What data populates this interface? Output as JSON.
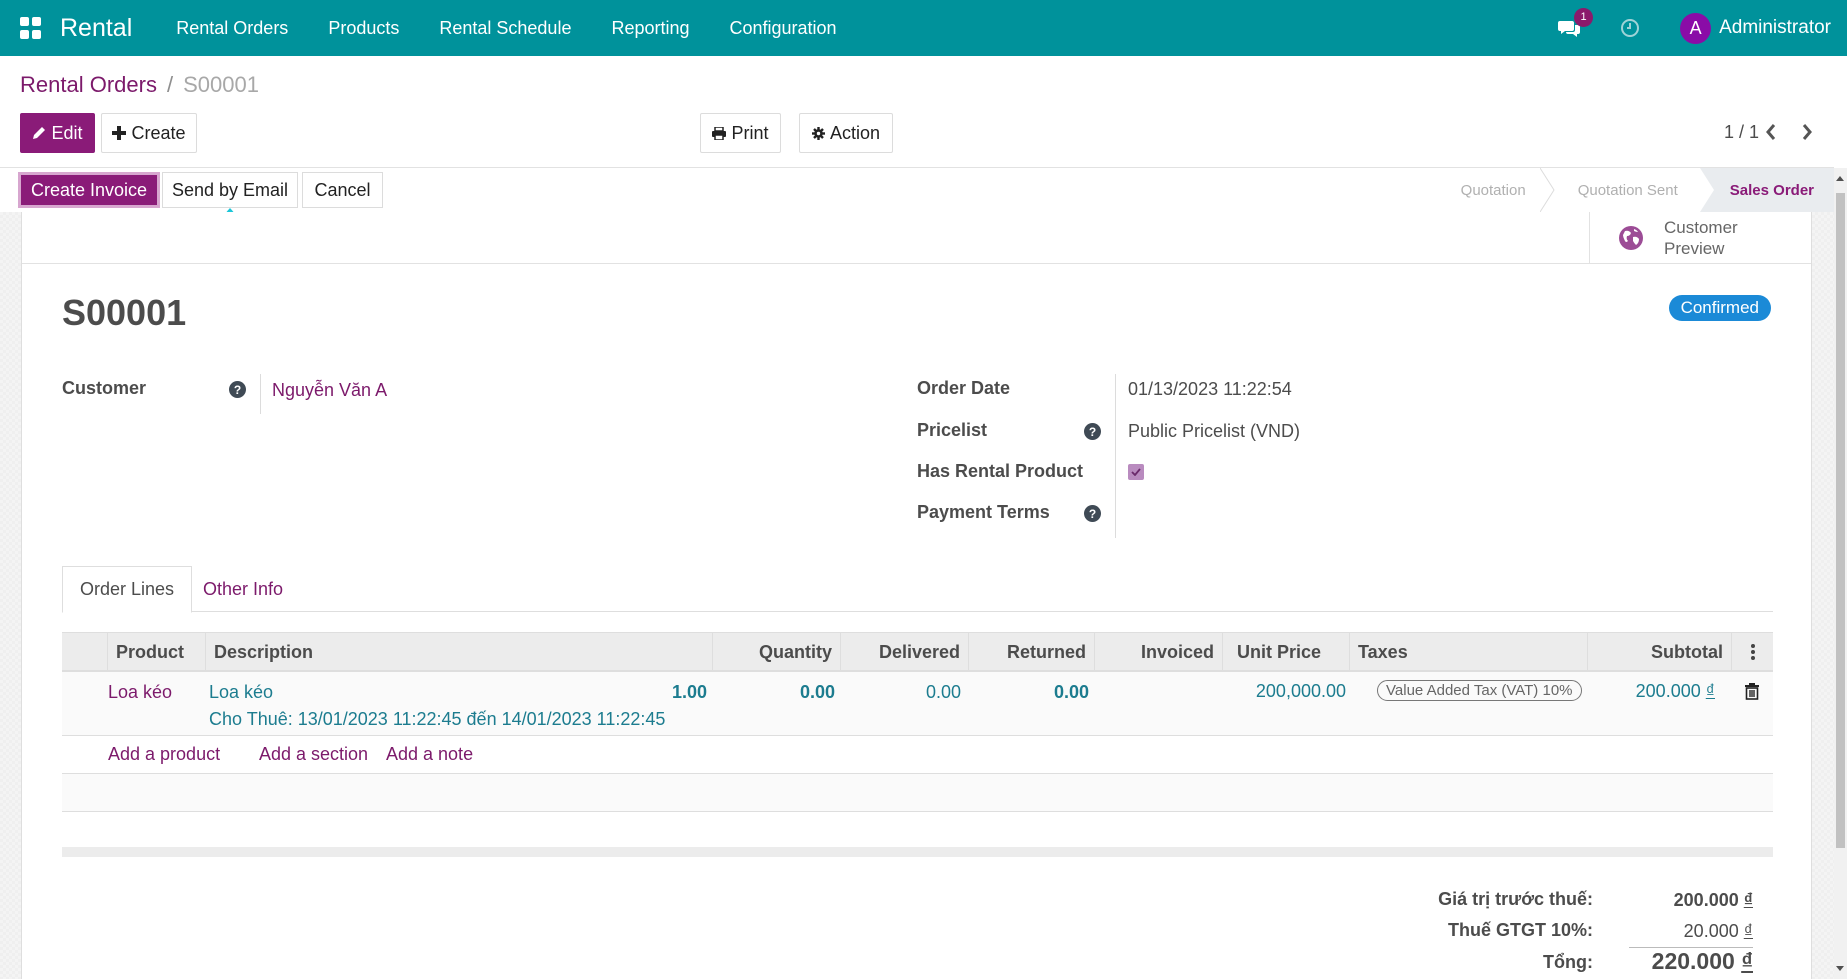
{
  "navbar": {
    "app_name": "Rental",
    "menu": [
      "Rental Orders",
      "Products",
      "Rental Schedule",
      "Reporting",
      "Configuration"
    ],
    "messages_count": "1",
    "user_initial": "A",
    "user_name": "Administrator",
    "brand_color": "#00929b"
  },
  "breadcrumb": {
    "parent": "Rental Orders",
    "separator": "/",
    "current": "S00001"
  },
  "toolbar": {
    "edit_label": "Edit",
    "create_label": "Create",
    "print_label": "Print",
    "action_label": "Action",
    "pager": "1 / 1"
  },
  "statusbar": {
    "buttons": [
      "Create Invoice",
      "Send by Email",
      "Cancel"
    ],
    "stages": [
      "Quotation",
      "Quotation Sent",
      "Sales Order"
    ],
    "active_stage": "Sales Order"
  },
  "smart_buttons": {
    "customer_preview_line1": "Customer",
    "customer_preview_line2": "Preview"
  },
  "record": {
    "name": "S00001",
    "status": "Confirmed",
    "customer_label": "Customer",
    "customer_value": "Nguyễn Văn A",
    "order_date_label": "Order Date",
    "order_date_value": "01/13/2023 11:22:54",
    "pricelist_label": "Pricelist",
    "pricelist_value": "Public Pricelist (VND)",
    "has_rental_label": "Has Rental Product",
    "has_rental_checked": true,
    "payment_terms_label": "Payment Terms",
    "payment_terms_value": ""
  },
  "tabs": [
    {
      "label": "Order Lines",
      "active": true
    },
    {
      "label": "Other Info",
      "active": false
    }
  ],
  "order_lines": {
    "columns": [
      "Product",
      "Description",
      "Quantity",
      "Delivered",
      "Returned",
      "Invoiced",
      "Unit Price",
      "Taxes",
      "Subtotal"
    ],
    "rows": [
      {
        "product": "Loa kéo",
        "description_line1": "Loa kéo",
        "description_line2": "Cho Thuê: 13/01/2023 11:22:45 đến 14/01/2023 11:22:45",
        "quantity": "1.00",
        "delivered": "0.00",
        "returned": "0.00",
        "invoiced": "0.00",
        "unit_price": "200,000.00",
        "tax": "Value Added Tax (VAT) 10%",
        "subtotal": "200.000",
        "currency": "₫"
      }
    ],
    "add_links": [
      "Add a product",
      "Add a section",
      "Add a note"
    ]
  },
  "totals": {
    "untaxed_label": "Giá trị trước thuế:",
    "untaxed_value": "200.000",
    "tax_label": "Thuế GTGT 10%:",
    "tax_value": "20.000",
    "total_label": "Tổng:",
    "total_value": "220.000",
    "currency": "₫"
  }
}
